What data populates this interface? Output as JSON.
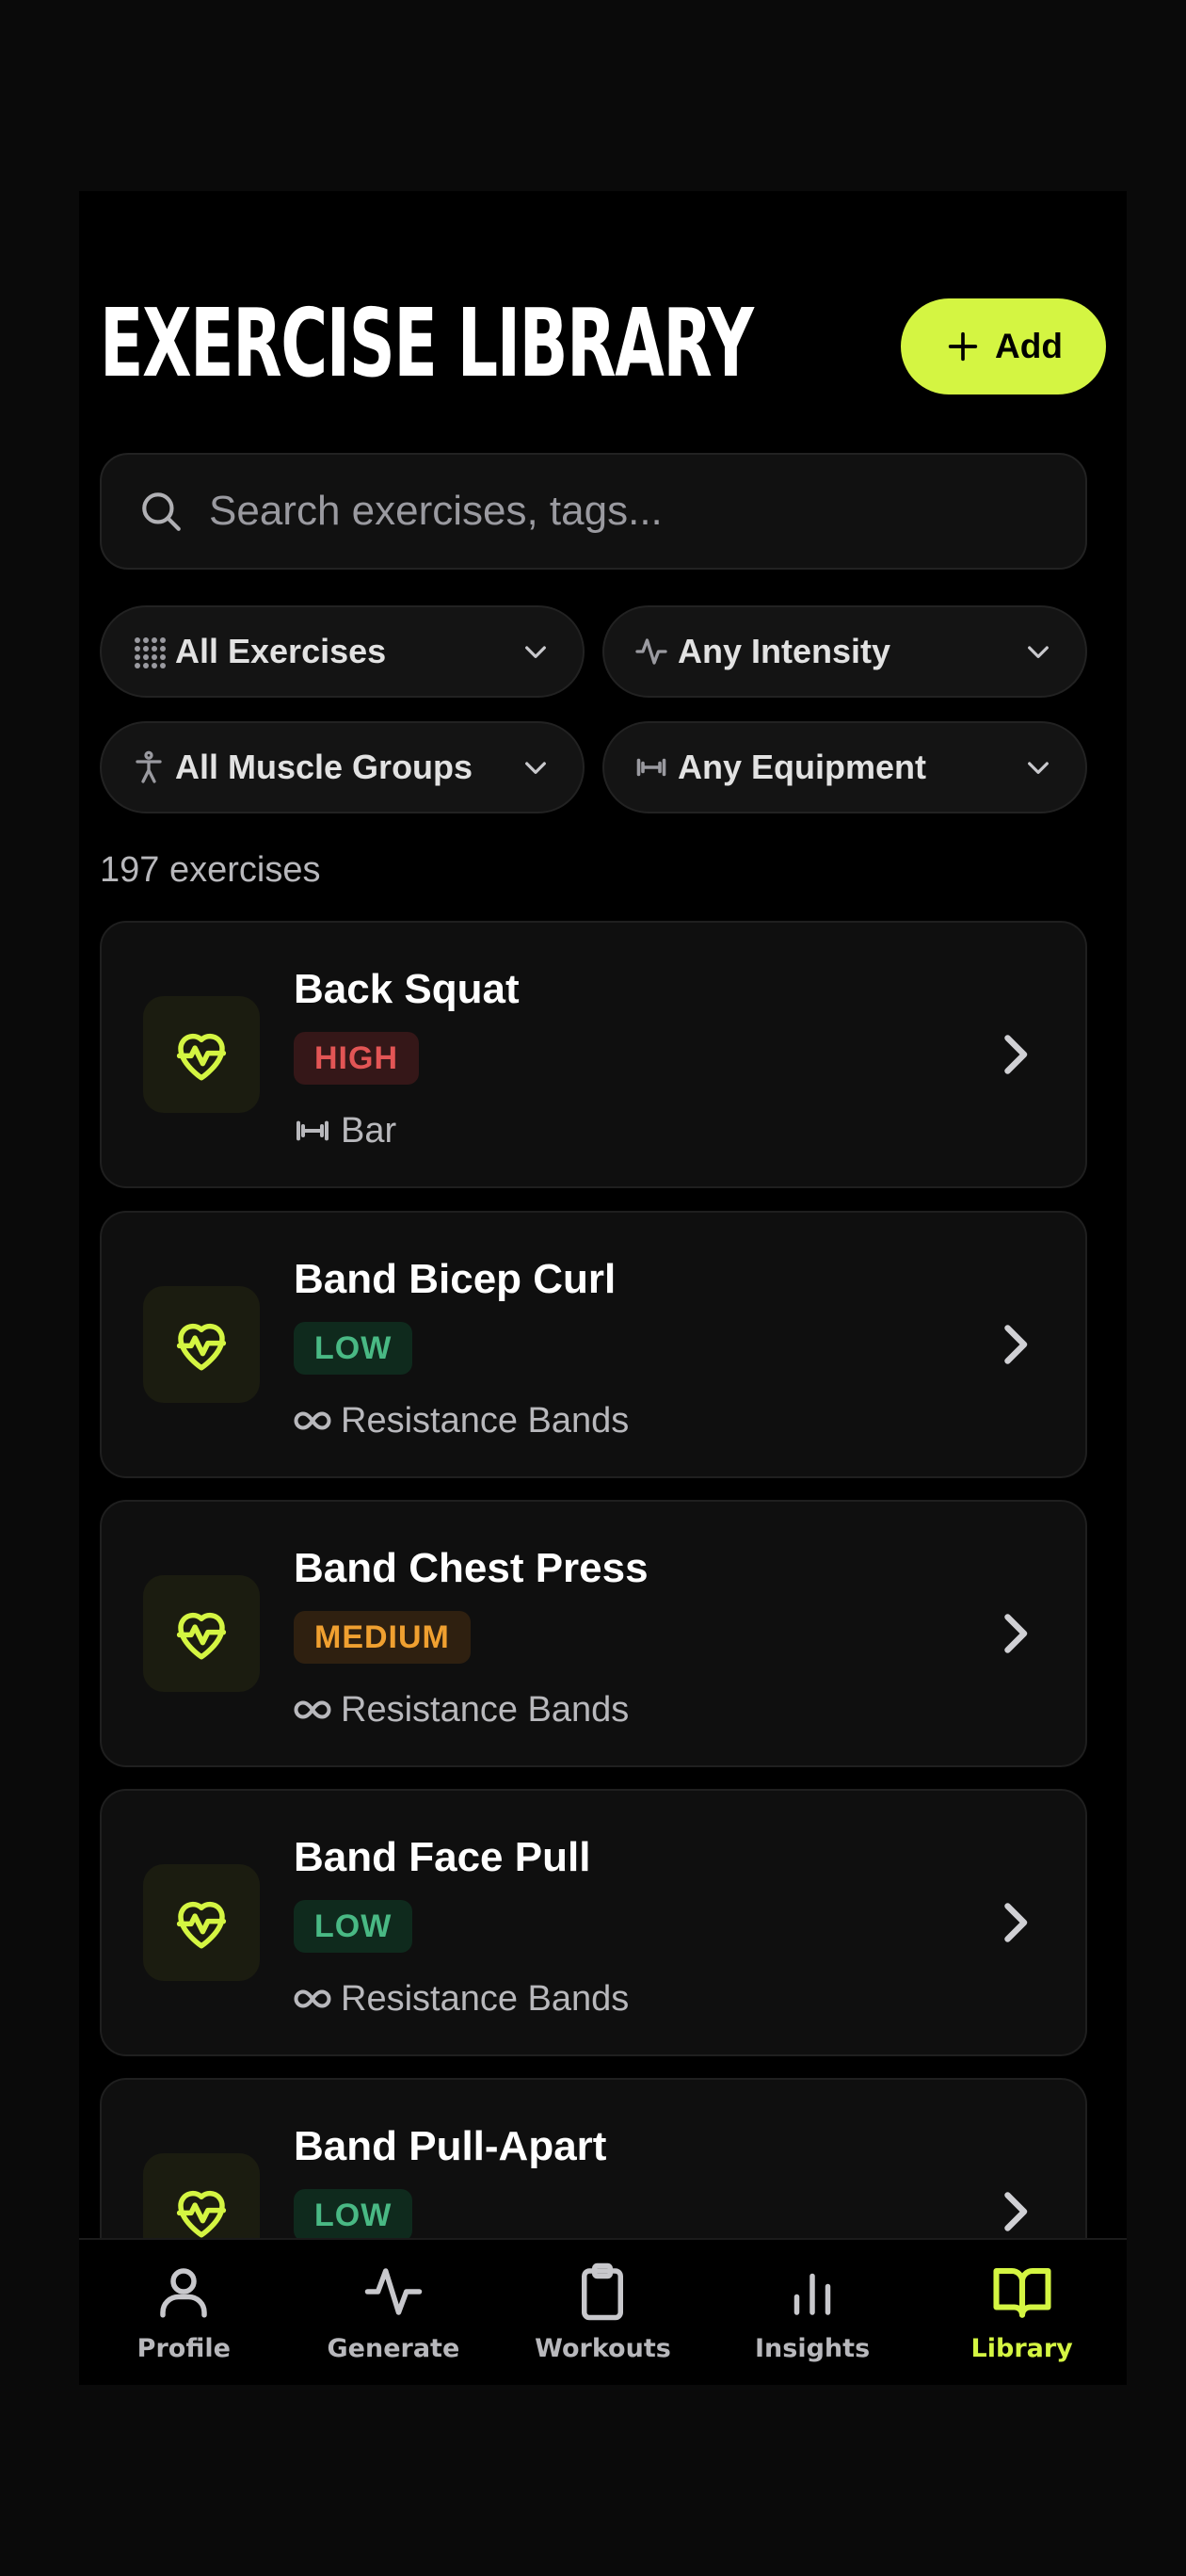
{
  "header": {
    "title": "EXERCISE LIBRARY",
    "add_label": "Add"
  },
  "search": {
    "placeholder": "Search exercises, tags..."
  },
  "filters": [
    {
      "label": "All Exercises",
      "icon": "grid-icon"
    },
    {
      "label": "Any Intensity",
      "icon": "activity-icon"
    },
    {
      "label": "All Muscle Groups",
      "icon": "person-icon"
    },
    {
      "label": "Any Equipment",
      "icon": "dumbbell-icon"
    }
  ],
  "count_text": "197 exercises",
  "exercises": [
    {
      "name": "Back Squat",
      "intensity": "HIGH",
      "equipment": "Bar",
      "equipment_icon": "dumbbell-icon"
    },
    {
      "name": "Band Bicep Curl",
      "intensity": "LOW",
      "equipment": "Resistance Bands",
      "equipment_icon": "infinity-icon"
    },
    {
      "name": "Band Chest Press",
      "intensity": "MEDIUM",
      "equipment": "Resistance Bands",
      "equipment_icon": "infinity-icon"
    },
    {
      "name": "Band Face Pull",
      "intensity": "LOW",
      "equipment": "Resistance Bands",
      "equipment_icon": "infinity-icon"
    },
    {
      "name": "Band Pull-Apart",
      "intensity": "LOW",
      "equipment": "",
      "equipment_icon": ""
    }
  ],
  "nav": [
    {
      "label": "Profile",
      "icon": "user-icon",
      "active": false
    },
    {
      "label": "Generate",
      "icon": "activity-icon",
      "active": false
    },
    {
      "label": "Workouts",
      "icon": "clipboard-icon",
      "active": false
    },
    {
      "label": "Insights",
      "icon": "bar-chart-icon",
      "active": false
    },
    {
      "label": "Library",
      "icon": "book-open-icon",
      "active": true
    }
  ],
  "colors": {
    "accent": "#d4f542",
    "high": "#e25555",
    "low": "#49b984",
    "medium": "#f0a030"
  }
}
